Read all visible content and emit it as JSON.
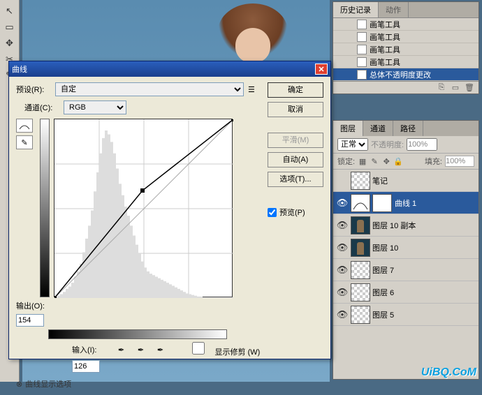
{
  "toolbar": {
    "tools": [
      "↖",
      "▭",
      "✥",
      "✂",
      "✎"
    ]
  },
  "history": {
    "tab_history": "历史记录",
    "tab_actions": "动作",
    "items": [
      "画笔工具",
      "画笔工具",
      "画笔工具",
      "画笔工具",
      "总体不透明度更改"
    ],
    "selected_index": 4
  },
  "layers": {
    "tab_layers": "图层",
    "tab_channels": "通道",
    "tab_paths": "路径",
    "blend_mode": "正常",
    "opacity_label": "不透明度:",
    "opacity_value": "100%",
    "lock_label": "锁定:",
    "fill_label": "填充:",
    "fill_value": "100%",
    "rows": [
      {
        "name": "笔记",
        "eye": false,
        "thumb": "checker"
      },
      {
        "name": "曲线 1",
        "eye": true,
        "thumb": "curves",
        "selected": true,
        "mask": true
      },
      {
        "name": "图层 10 副本",
        "eye": true,
        "thumb": "figure"
      },
      {
        "name": "图层 10",
        "eye": true,
        "thumb": "figure"
      },
      {
        "name": "图层 7",
        "eye": true,
        "thumb": "checker"
      },
      {
        "name": "图层 6",
        "eye": true,
        "thumb": "checker"
      },
      {
        "name": "图层 5",
        "eye": true,
        "thumb": "checker"
      }
    ]
  },
  "dialog": {
    "title": "曲线",
    "preset_label": "预设(R):",
    "preset_value": "自定",
    "channel_label": "通道(C):",
    "channel_value": "RGB",
    "output_label": "输出(O):",
    "output_value": "154",
    "input_label": "输入(I):",
    "input_value": "126",
    "show_clip": "显示修剪 (W)",
    "expand": "曲线显示选项",
    "btn_ok": "确定",
    "btn_cancel": "取消",
    "btn_smooth": "平滑(M)",
    "btn_auto": "自动(A)",
    "btn_options": "选项(T)...",
    "preview": "预览(P)"
  },
  "chart_data": {
    "type": "line",
    "title": "曲线",
    "xlabel": "输入",
    "ylabel": "输出",
    "xlim": [
      0,
      255
    ],
    "ylim": [
      0,
      255
    ],
    "series": [
      {
        "name": "baseline",
        "values": [
          [
            0,
            0
          ],
          [
            255,
            255
          ]
        ]
      },
      {
        "name": "curve",
        "values": [
          [
            0,
            0
          ],
          [
            126,
            154
          ],
          [
            255,
            255
          ]
        ]
      }
    ],
    "control_point": {
      "input": 126,
      "output": 154
    },
    "histogram": [
      2,
      3,
      5,
      8,
      12,
      15,
      20,
      28,
      35,
      45,
      60,
      78,
      95,
      115,
      140,
      165,
      190,
      210,
      220,
      215,
      205,
      190,
      170,
      150,
      135,
      120,
      108,
      95,
      82,
      70,
      58,
      48,
      40,
      35,
      32,
      30,
      28,
      26,
      24,
      22,
      20,
      18,
      16,
      14,
      12,
      10,
      8,
      6,
      5,
      4,
      3,
      2,
      2,
      1,
      1,
      1,
      1,
      1,
      1,
      1,
      1,
      1,
      1,
      1
    ]
  },
  "watermark": "UiBQ.CoM"
}
